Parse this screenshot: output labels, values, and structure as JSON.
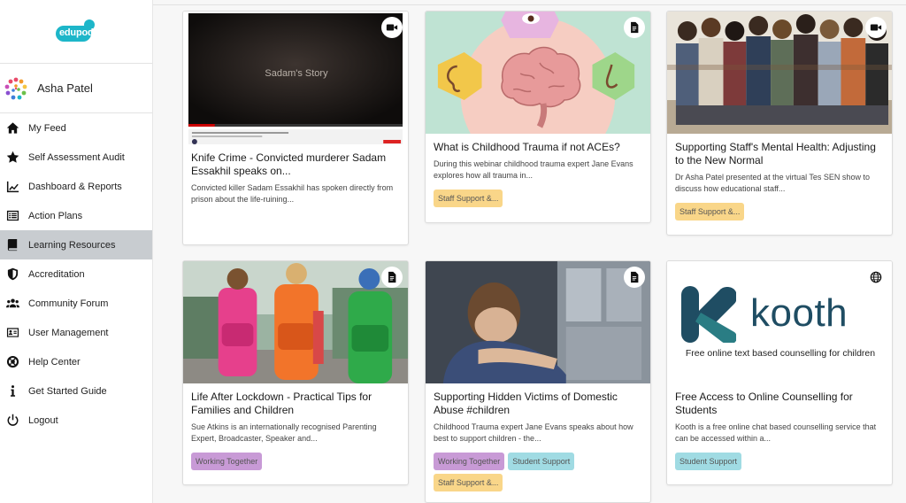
{
  "brand": {
    "logo_text": "edupod",
    "color": "#1db6c9"
  },
  "user": {
    "name": "Asha Patel"
  },
  "nav": [
    {
      "label": "My Feed",
      "icon": "home-icon"
    },
    {
      "label": "Self Assessment Audit",
      "icon": "star-icon"
    },
    {
      "label": "Dashboard & Reports",
      "icon": "chart-icon"
    },
    {
      "label": "Action Plans",
      "icon": "list-icon"
    },
    {
      "label": "Learning Resources",
      "icon": "book-icon",
      "active": true
    },
    {
      "label": "Accreditation",
      "icon": "shield-icon"
    },
    {
      "label": "Community Forum",
      "icon": "users-icon"
    },
    {
      "label": "User Management",
      "icon": "id-card-icon"
    },
    {
      "label": "Help Center",
      "icon": "lifebuoy-icon"
    },
    {
      "label": "Get Started Guide",
      "icon": "info-icon"
    },
    {
      "label": "Logout",
      "icon": "power-icon"
    }
  ],
  "cards": [
    {
      "title": "Knife Crime - Convicted murderer Sadam Essakhil speaks on...",
      "description": "Convicted killer Sadam Essakhil has spoken directly from prison about the life-ruining...",
      "media": "video-icon",
      "thumb_text": "Sadam's Story",
      "tags": []
    },
    {
      "title": "What is Childhood Trauma if not ACEs?",
      "description": "During this webinar childhood trauma expert Jane Evans explores how all trauma in...",
      "media": "document-icon",
      "tags": [
        {
          "label": "Staff Support &...",
          "color": "orange"
        }
      ]
    },
    {
      "title": "Supporting Staff's Mental Health: Adjusting to the New Normal",
      "description": "Dr Asha Patel presented at the virtual Tes SEN show to discuss how educational staff...",
      "media": "video-icon",
      "tags": [
        {
          "label": "Staff Support &...",
          "color": "orange"
        }
      ]
    },
    {
      "title": "Life After Lockdown - Practical Tips for Families and Children",
      "description": "Sue Atkins is an internationally recognised Parenting Expert, Broadcaster, Speaker and...",
      "media": "document-icon",
      "tags": [
        {
          "label": "Working Together",
          "color": "purple"
        }
      ]
    },
    {
      "title": "Supporting Hidden Victims of Domestic Abuse #children",
      "description": "Childhood Trauma expert Jane Evans speaks about how best to support children - the...",
      "media": "document-icon",
      "tags": [
        {
          "label": "Working Together",
          "color": "purple"
        },
        {
          "label": "Student Support",
          "color": "blue"
        },
        {
          "label": "Staff Support &...",
          "color": "orange"
        }
      ]
    },
    {
      "title": "Free Access to Online Counselling for Students",
      "description": "Kooth is a free online chat based counselling service that can be accessed within a...",
      "media": "globe-icon",
      "thumb_brand": "kooth",
      "thumb_caption": "Free online text based counselling for children",
      "tags": [
        {
          "label": "Student Support",
          "color": "blue"
        }
      ]
    }
  ]
}
